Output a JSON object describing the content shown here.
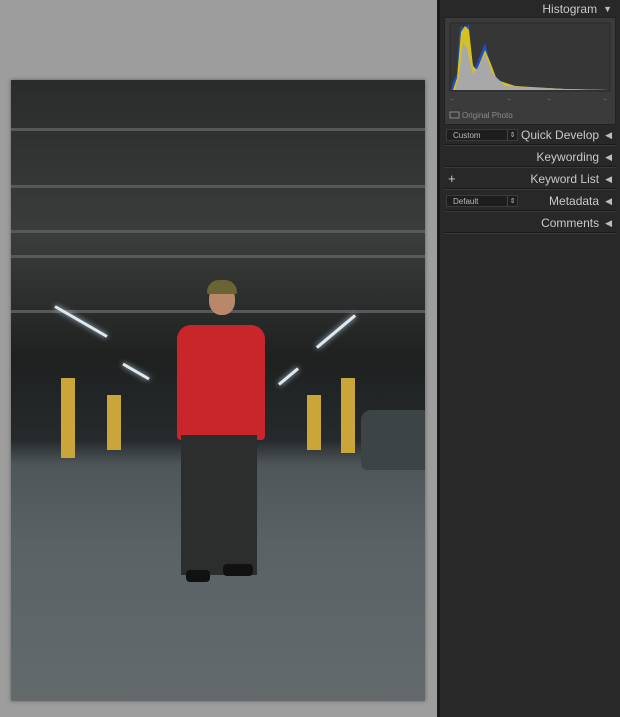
{
  "panel": {
    "histogram": {
      "title": "Histogram",
      "original_photo_label": "Original Photo"
    },
    "quick_develop": {
      "title": "Quick Develop",
      "preset": "Custom"
    },
    "keywording": {
      "title": "Keywording"
    },
    "keyword_list": {
      "title": "Keyword List",
      "add_symbol": "+"
    },
    "metadata": {
      "title": "Metadata",
      "preset": "Default"
    },
    "comments": {
      "title": "Comments"
    },
    "expanded_symbol": "▼",
    "collapsed_symbol": "◀"
  },
  "colors": {
    "panel_bg": "#282828",
    "canvas_bg": "#9d9d9d"
  }
}
